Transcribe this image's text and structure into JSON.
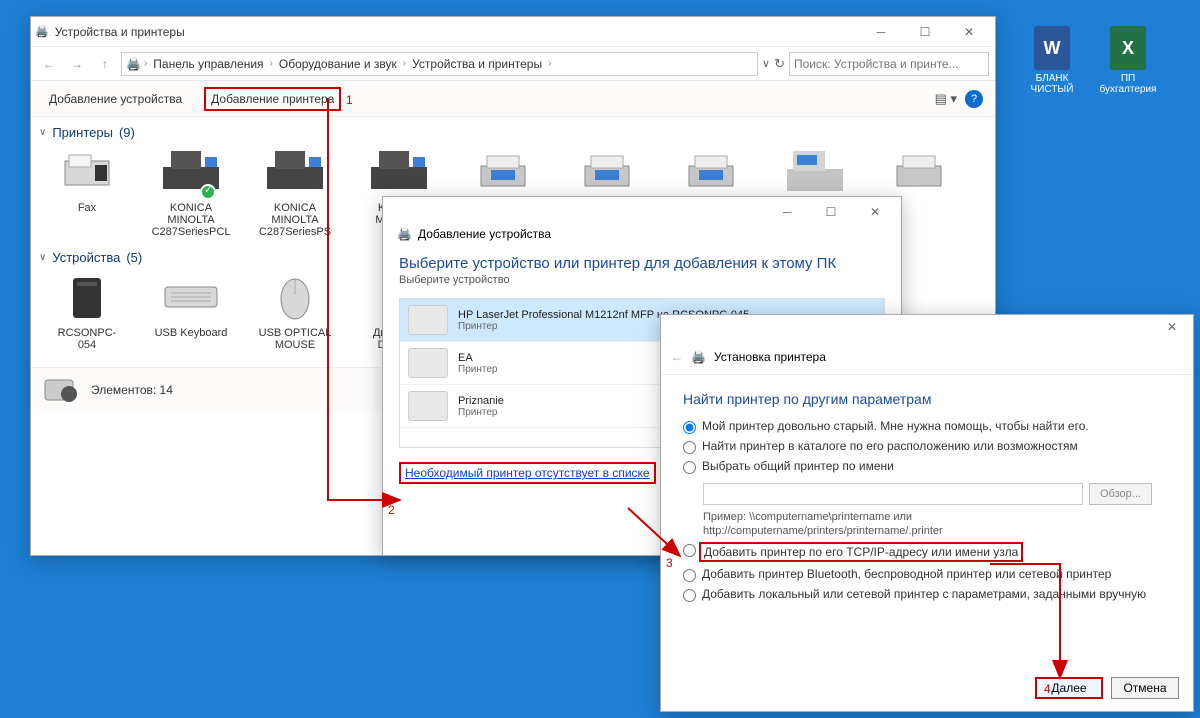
{
  "desktop": {
    "icons": [
      {
        "label": "БЛАНК ЧИСТЫЙ",
        "color": "#2b579a",
        "letter": "W"
      },
      {
        "label": "ПП бухгалтерия",
        "color": "#217346",
        "letter": "X"
      }
    ]
  },
  "main_window": {
    "title": "Устройства и принтеры",
    "breadcrumb": [
      "Панель управления",
      "Оборудование и звук",
      "Устройства и принтеры"
    ],
    "search_placeholder": "Поиск: Устройства и принте...",
    "commands": {
      "add_device": "Добавление устройства",
      "add_printer": "Добавление принтера"
    },
    "groups": {
      "printers": {
        "title": "Принтеры",
        "count": "(9)",
        "items": [
          {
            "name": "Fax"
          },
          {
            "name": "KONICA MINOLTA C287SeriesPCL",
            "check": true
          },
          {
            "name": "KONICA MINOLTA C287SeriesPS"
          },
          {
            "name": "KONICA MINOLTA C287S"
          },
          {
            "name": ""
          },
          {
            "name": ""
          },
          {
            "name": ""
          },
          {
            "name": ""
          },
          {
            "name": ""
          }
        ]
      },
      "devices": {
        "title": "Устройства",
        "count": "(5)",
        "items": [
          {
            "name": "RCSONPC-054"
          },
          {
            "name": "USB Keyboard"
          },
          {
            "name": "USB OPTICAL MOUSE"
          },
          {
            "name": "Дин (Realt Definiti..."
          },
          {
            "name": ""
          }
        ]
      }
    },
    "status": {
      "elements_label": "Элементов: 14"
    }
  },
  "dialog_add": {
    "title": "Добавление устройства",
    "heading": "Выберите устройство или принтер для добавления к этому ПК",
    "sub": "Выберите устройство",
    "list": [
      {
        "name": "HP LaserJet Professional M1212nf MFP на RCSONPC-045",
        "sub": "Принтер",
        "sel": true
      },
      {
        "name": "EA",
        "sub": "Принтер"
      },
      {
        "name": "Priznanie",
        "sub": "Принтер"
      }
    ],
    "link": "Необходимый принтер отсутствует в списке"
  },
  "dialog_find": {
    "title": "Установка принтера",
    "heading": "Найти принтер по другим параметрам",
    "options": {
      "o1": "Мой принтер довольно старый. Мне нужна помощь, чтобы найти его.",
      "o2": "Найти принтер в каталоге по его расположению или возможностям",
      "o3": "Выбрать общий принтер по имени",
      "o3_browse": "Обзор...",
      "o3_ex1": "Пример: \\\\computername\\printername или",
      "o3_ex2": "http://computername/printers/printername/.printer",
      "o4": "Добавить принтер по его TCP/IP-адресу или имени узла",
      "o5": "Добавить принтер Bluetooth, беспроводной принтер или сетевой принтер",
      "o6": "Добавить локальный или сетевой принтер с параметрами, заданными вручную"
    },
    "buttons": {
      "next": "Далее",
      "cancel": "Отмена"
    }
  },
  "annotation_numbers": {
    "n1": "1",
    "n2": "2",
    "n3": "3",
    "n4": "4"
  }
}
